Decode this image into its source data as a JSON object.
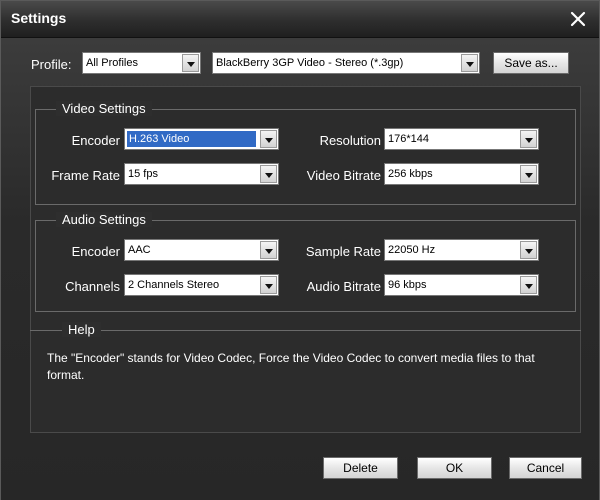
{
  "window": {
    "title": "Settings"
  },
  "profile": {
    "label": "Profile:",
    "category": "All Profiles",
    "preset": "BlackBerry 3GP Video - Stereo (*.3gp)",
    "save_as_label": "Save as..."
  },
  "video": {
    "title": "Video Settings",
    "encoder_label": "Encoder",
    "encoder_value": "H.263 Video",
    "resolution_label": "Resolution",
    "resolution_value": "176*144",
    "frame_rate_label": "Frame Rate",
    "frame_rate_value": "15 fps",
    "bitrate_label": "Video Bitrate",
    "bitrate_value": "256 kbps"
  },
  "audio": {
    "title": "Audio Settings",
    "encoder_label": "Encoder",
    "encoder_value": "AAC",
    "sample_rate_label": "Sample Rate",
    "sample_rate_value": "22050 Hz",
    "channels_label": "Channels",
    "channels_value": "2 Channels Stereo",
    "bitrate_label": "Audio Bitrate",
    "bitrate_value": "96 kbps"
  },
  "help": {
    "title": "Help",
    "text": "The \"Encoder\" stands for Video Codec, Force the Video Codec to convert media files to that format."
  },
  "buttons": {
    "delete": "Delete",
    "ok": "OK",
    "cancel": "Cancel"
  },
  "colors": {
    "accent_selection": "#316ac5",
    "background": "#2b2b2b",
    "text": "#ffffff"
  }
}
